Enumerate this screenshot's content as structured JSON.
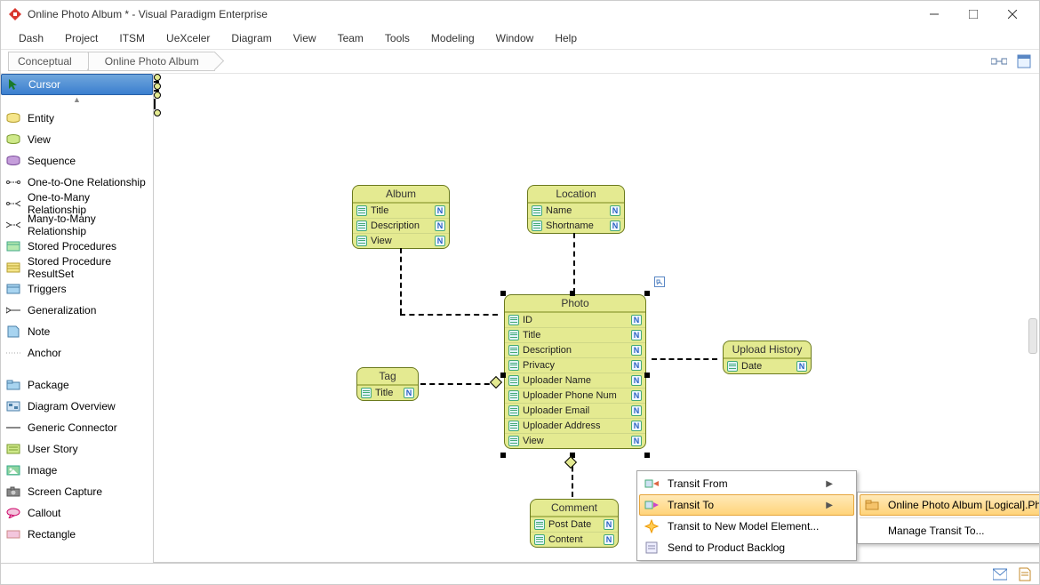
{
  "window": {
    "title": "Online Photo Album * - Visual Paradigm Enterprise"
  },
  "menu": [
    "Dash",
    "Project",
    "ITSM",
    "UeXceler",
    "Diagram",
    "View",
    "Team",
    "Tools",
    "Modeling",
    "Window",
    "Help"
  ],
  "crumbs": [
    "Conceptual",
    "Online Photo Album"
  ],
  "palette": {
    "cursor": "Cursor",
    "group1": [
      "Entity",
      "View",
      "Sequence",
      "One-to-One Relationship",
      "One-to-Many Relationship",
      "Many-to-Many Relationship",
      "Stored Procedures",
      "Stored Procedure ResultSet",
      "Triggers",
      "Generalization",
      "Note",
      "Anchor"
    ],
    "group2": [
      "Package",
      "Diagram Overview",
      "Generic Connector",
      "User Story",
      "Image",
      "Screen Capture",
      "Callout",
      "Rectangle"
    ]
  },
  "entities": {
    "album": {
      "title": "Album",
      "cols": [
        "Title",
        "Description",
        "View"
      ]
    },
    "location": {
      "title": "Location",
      "cols": [
        "Name",
        "Shortname"
      ]
    },
    "tag": {
      "title": "Tag",
      "cols": [
        "Title"
      ]
    },
    "photo": {
      "title": "Photo",
      "cols": [
        "ID",
        "Title",
        "Description",
        "Privacy",
        "Uploader Name",
        "Uploader Phone Num",
        "Uploader Email",
        "Uploader Address",
        "View"
      ]
    },
    "upload": {
      "title": "Upload History",
      "cols": [
        "Date"
      ]
    },
    "comment": {
      "title": "Comment",
      "cols": [
        "Post Date",
        "Content"
      ]
    }
  },
  "ctx": {
    "items": [
      {
        "label": "Transit From",
        "sub": true
      },
      {
        "label": "Transit To",
        "sub": true,
        "hover": true
      },
      {
        "label": "Transit to New Model Element..."
      },
      {
        "label": "Send to Product Backlog"
      }
    ],
    "sub": [
      {
        "label": "Online Photo Album [Logical].Photo",
        "hover": true
      },
      {
        "label": "Manage Transit To..."
      }
    ]
  }
}
